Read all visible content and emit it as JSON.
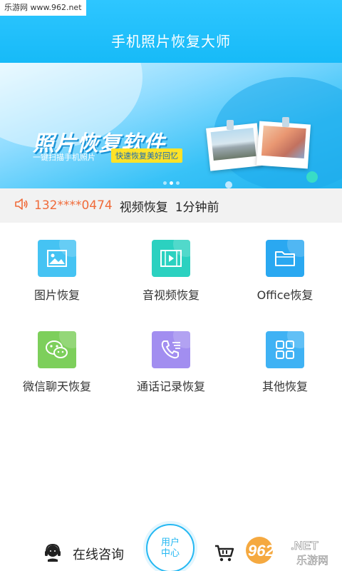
{
  "watermark_top": "乐游网 www.962.net",
  "header": {
    "title": "手机照片恢复大师"
  },
  "banner": {
    "title": "照片恢复软件",
    "subtitle": "一键扫描手机照片",
    "tag": "快速恢复美好回忆",
    "page_count": 3,
    "active_page": 1
  },
  "ticker": {
    "phone": "132****0474",
    "action": "视频恢复",
    "time": "1分钟前"
  },
  "grid": {
    "items": [
      {
        "label": "图片恢复",
        "color": "#45c3f3"
      },
      {
        "label": "音视频恢复",
        "color": "#2bd1c0"
      },
      {
        "label": "Office恢复",
        "color": "#2aa8f1"
      },
      {
        "label": "微信聊天恢复",
        "color": "#7dcf5b"
      },
      {
        "label": "通话记录恢复",
        "color": "#a28ef0"
      },
      {
        "label": "其他恢复",
        "color": "#3fb2f4"
      }
    ]
  },
  "bottom": {
    "consult_label": "在线咨询",
    "center_line1": "用户",
    "center_line2": "中心",
    "wm_brand": "962",
    "wm_net": ".NET",
    "wm_cn": "乐游网"
  }
}
